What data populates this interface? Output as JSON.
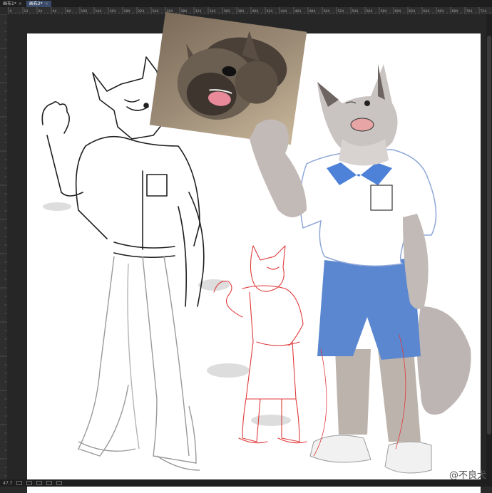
{
  "tabs": [
    {
      "label": "画布1*",
      "close": "×"
    },
    {
      "label": "画布2*",
      "close": "×"
    }
  ],
  "ruler_ticks": [
    "0",
    "14",
    "24",
    "44",
    "84",
    "100",
    "144",
    "164",
    "184",
    "224",
    "244",
    "264",
    "284",
    "324",
    "344",
    "364",
    "384",
    "404",
    "424",
    "444",
    "464",
    "484",
    "504",
    "524",
    "544",
    "564",
    "584",
    "604",
    "624",
    "644",
    "664",
    "684",
    "704",
    "724"
  ],
  "status": {
    "zoom": "47.7"
  },
  "watermark": "@不良犬",
  "colors": {
    "shorts": "#5a87d0",
    "collar": "#4d82d8",
    "fur": "#c9c3c2",
    "red_sketch": "#e03a3a",
    "pencil": "#2a2a2a"
  }
}
